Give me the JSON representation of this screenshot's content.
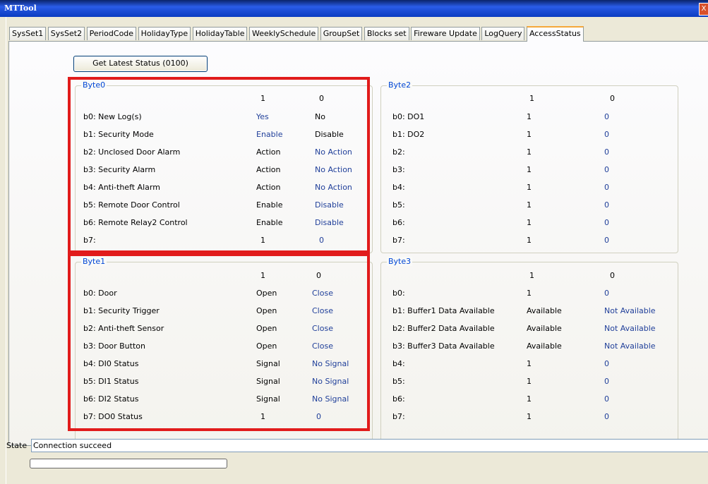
{
  "window": {
    "title": "MTTool",
    "close_glyph": "X"
  },
  "tabs": [
    "SysSet1",
    "SysSet2",
    "PeriodCode",
    "HolidayType",
    "HolidayTable",
    "WeeklySchedule",
    "GroupSet",
    "Blocks set",
    "Fireware Update",
    "LogQuery",
    "AccessStatus"
  ],
  "active_tab": "AccessStatus",
  "button": {
    "get_latest": "Get Latest Status (0100)"
  },
  "groups": {
    "byte0": {
      "legend": "Byte0",
      "col1": "1",
      "col0": "0",
      "rows": [
        {
          "label": "b0: New Log(s)",
          "v1": "Yes",
          "v0": "No"
        },
        {
          "label": "b1: Security Mode",
          "v1": "Enable",
          "v0": "Disable"
        },
        {
          "label": "b2: Unclosed Door Alarm",
          "v1": "Action",
          "v0": "No Action"
        },
        {
          "label": "b3: Security Alarm",
          "v1": "Action",
          "v0": "No Action"
        },
        {
          "label": "b4: Anti-theft Alarm",
          "v1": "Action",
          "v0": "No Action"
        },
        {
          "label": "b5: Remote Door Control",
          "v1": "Enable",
          "v0": "Disable"
        },
        {
          "label": "b6: Remote Relay2 Control",
          "v1": "Enable",
          "v0": "Disable"
        },
        {
          "label": "b7:",
          "v1": "1",
          "v0": "0"
        }
      ]
    },
    "byte1": {
      "legend": "Byte1",
      "col1": "1",
      "col0": "0",
      "rows": [
        {
          "label": "b0: Door",
          "v1": "Open",
          "v0": "Close"
        },
        {
          "label": "b1: Security Trigger",
          "v1": "Open",
          "v0": "Close"
        },
        {
          "label": "b2: Anti-theft Sensor",
          "v1": "Open",
          "v0": "Close"
        },
        {
          "label": "b3: Door Button",
          "v1": "Open",
          "v0": "Close"
        },
        {
          "label": "b4: DI0 Status",
          "v1": "Signal",
          "v0": "No Signal"
        },
        {
          "label": "b5: DI1 Status",
          "v1": "Signal",
          "v0": "No Signal"
        },
        {
          "label": "b6: DI2 Status",
          "v1": "Signal",
          "v0": "No Signal"
        },
        {
          "label": "b7: DO0 Status",
          "v1": "1",
          "v0": "0"
        }
      ]
    },
    "byte2": {
      "legend": "Byte2",
      "col1": "1",
      "col0": "0",
      "rows": [
        {
          "label": "b0: DO1",
          "v1": "1",
          "v0": "0"
        },
        {
          "label": "b1: DO2",
          "v1": "1",
          "v0": "0"
        },
        {
          "label": "b2:",
          "v1": "1",
          "v0": "0"
        },
        {
          "label": "b3:",
          "v1": "1",
          "v0": "0"
        },
        {
          "label": "b4:",
          "v1": "1",
          "v0": "0"
        },
        {
          "label": "b5:",
          "v1": "1",
          "v0": "0"
        },
        {
          "label": "b6:",
          "v1": "1",
          "v0": "0"
        },
        {
          "label": "b7:",
          "v1": "1",
          "v0": "0"
        }
      ]
    },
    "byte3": {
      "legend": "Byte3",
      "col1": "1",
      "col0": "0",
      "rows": [
        {
          "label": "b0:",
          "v1": "1",
          "v0": "0"
        },
        {
          "label": "b1: Buffer1 Data Available",
          "v1": "Available",
          "v0": "Not Available"
        },
        {
          "label": "b2: Buffer2 Data Available",
          "v1": "Available",
          "v0": "Not Available"
        },
        {
          "label": "b3: Buffer3 Data Available",
          "v1": "Available",
          "v0": "Not Available"
        },
        {
          "label": "b4:",
          "v1": "1",
          "v0": "0"
        },
        {
          "label": "b5:",
          "v1": "1",
          "v0": "0"
        },
        {
          "label": "b6:",
          "v1": "1",
          "v0": "0"
        },
        {
          "label": "b7:",
          "v1": "1",
          "v0": "0"
        }
      ]
    }
  },
  "status": {
    "label": "State",
    "value": "Connection succeed"
  },
  "colors": {
    "highlight": "#e11b1b",
    "value_blue": "#21409a",
    "legend_blue": "#0046d5"
  }
}
